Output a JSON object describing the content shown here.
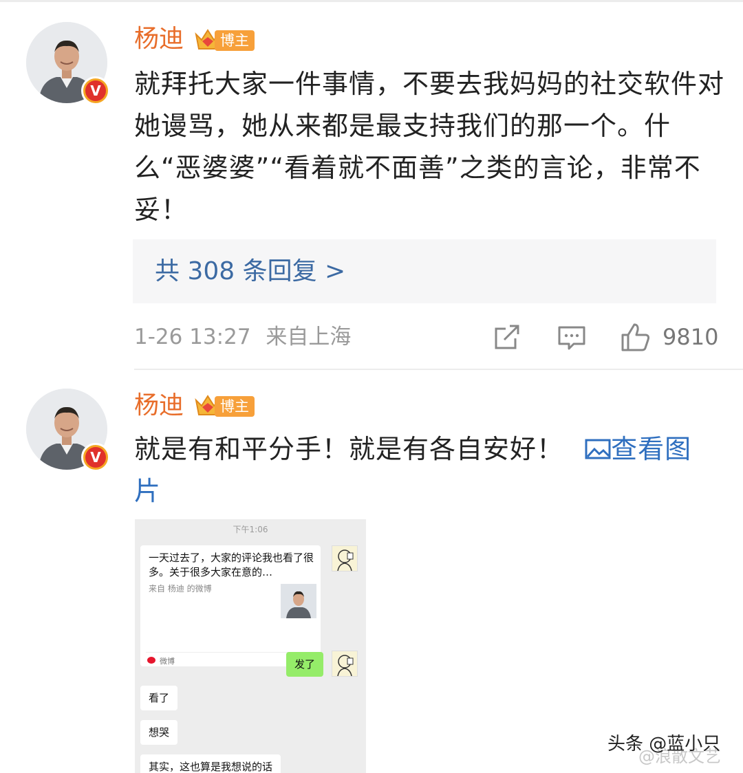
{
  "comments": [
    {
      "username": "杨迪",
      "badge_label": "博主",
      "verified_mark": "V",
      "text": "就拜托大家一件事情，不要去我妈妈的社交软件对她谩骂，她从来都是最支持我们的那一个。什么“恶婆婆”“看着就不面善”之类的言论，非常不妥！",
      "replies_label": "共 308 条回复 >",
      "time": "1-26 13:27",
      "location": "来自上海",
      "like_count": "9810"
    },
    {
      "username": "杨迪",
      "badge_label": "博主",
      "verified_mark": "V",
      "text": "就是有和平分手！就是有各自安好！",
      "view_image_label": "查看图片"
    }
  ],
  "chat_screenshot": {
    "time": "下午1:06",
    "card_text": "一天过去了，大家的评论我也看了很多。关于很多大家在意的…",
    "card_source": "来自 杨迪 的微博",
    "card_footer": "微博",
    "sent_message": "发了",
    "replies": [
      "看了",
      "想哭",
      "其实，这也算是我想说的话"
    ]
  },
  "watermark": {
    "primary": "头条 @蓝小只",
    "secondary": "@浪散文艺"
  },
  "icons": [
    "share-icon",
    "comment-icon",
    "like-icon",
    "image-icon",
    "crown-icon",
    "verified-icon"
  ],
  "colors": {
    "username": "#e86d2a",
    "link": "#2f6fbf",
    "badge": "#f7a03a",
    "reply_bg": "#f6f6f7",
    "chat_green": "#95ec69"
  }
}
